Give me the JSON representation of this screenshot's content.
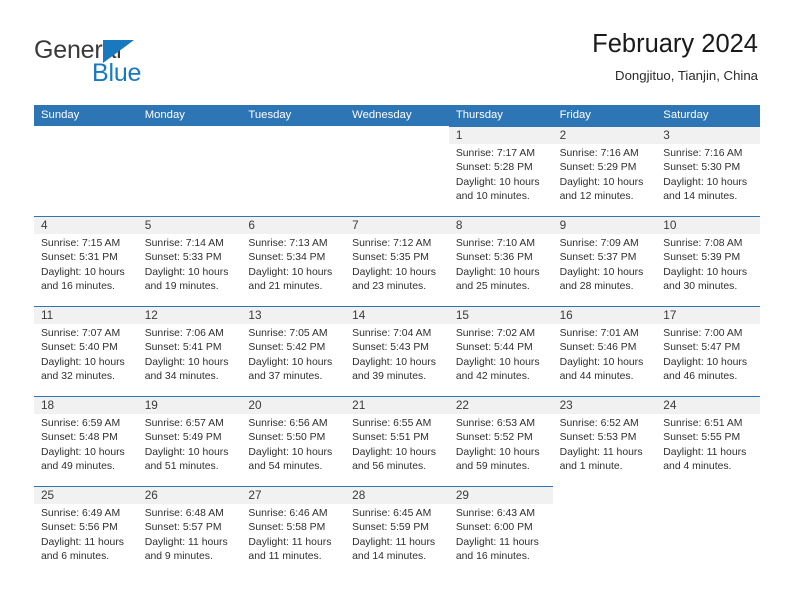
{
  "logo": {
    "word1": "General",
    "word2": "Blue",
    "triangle_color": "#1879bf",
    "word1_color": "#3a3a3a",
    "word2_color": "#1879bf",
    "icon": "triangle-flag-icon"
  },
  "header": {
    "title": "February 2024",
    "subtitle": "Dongjituo, Tianjin, China"
  },
  "colors": {
    "header_blue": "#2e75b6",
    "daynum_band": "#f1f1f1",
    "text": "#2f2f2f"
  },
  "weekdays": [
    "Sunday",
    "Monday",
    "Tuesday",
    "Wednesday",
    "Thursday",
    "Friday",
    "Saturday"
  ],
  "weeks": [
    [
      {
        "day": "",
        "state": "blank",
        "sunrise": "",
        "sunset": "",
        "daylight_1": "",
        "daylight_2": ""
      },
      {
        "day": "",
        "state": "blank",
        "sunrise": "",
        "sunset": "",
        "daylight_1": "",
        "daylight_2": ""
      },
      {
        "day": "",
        "state": "blank",
        "sunrise": "",
        "sunset": "",
        "daylight_1": "",
        "daylight_2": ""
      },
      {
        "day": "",
        "state": "blank",
        "sunrise": "",
        "sunset": "",
        "daylight_1": "",
        "daylight_2": ""
      },
      {
        "day": "1",
        "state": "filled",
        "sunrise": "Sunrise: 7:17 AM",
        "sunset": "Sunset: 5:28 PM",
        "daylight_1": "Daylight: 10 hours",
        "daylight_2": "and 10 minutes."
      },
      {
        "day": "2",
        "state": "filled",
        "sunrise": "Sunrise: 7:16 AM",
        "sunset": "Sunset: 5:29 PM",
        "daylight_1": "Daylight: 10 hours",
        "daylight_2": "and 12 minutes."
      },
      {
        "day": "3",
        "state": "filled",
        "sunrise": "Sunrise: 7:16 AM",
        "sunset": "Sunset: 5:30 PM",
        "daylight_1": "Daylight: 10 hours",
        "daylight_2": "and 14 minutes."
      }
    ],
    [
      {
        "day": "4",
        "state": "filled",
        "sunrise": "Sunrise: 7:15 AM",
        "sunset": "Sunset: 5:31 PM",
        "daylight_1": "Daylight: 10 hours",
        "daylight_2": "and 16 minutes."
      },
      {
        "day": "5",
        "state": "filled",
        "sunrise": "Sunrise: 7:14 AM",
        "sunset": "Sunset: 5:33 PM",
        "daylight_1": "Daylight: 10 hours",
        "daylight_2": "and 19 minutes."
      },
      {
        "day": "6",
        "state": "filled",
        "sunrise": "Sunrise: 7:13 AM",
        "sunset": "Sunset: 5:34 PM",
        "daylight_1": "Daylight: 10 hours",
        "daylight_2": "and 21 minutes."
      },
      {
        "day": "7",
        "state": "filled",
        "sunrise": "Sunrise: 7:12 AM",
        "sunset": "Sunset: 5:35 PM",
        "daylight_1": "Daylight: 10 hours",
        "daylight_2": "and 23 minutes."
      },
      {
        "day": "8",
        "state": "filled",
        "sunrise": "Sunrise: 7:10 AM",
        "sunset": "Sunset: 5:36 PM",
        "daylight_1": "Daylight: 10 hours",
        "daylight_2": "and 25 minutes."
      },
      {
        "day": "9",
        "state": "filled",
        "sunrise": "Sunrise: 7:09 AM",
        "sunset": "Sunset: 5:37 PM",
        "daylight_1": "Daylight: 10 hours",
        "daylight_2": "and 28 minutes."
      },
      {
        "day": "10",
        "state": "filled",
        "sunrise": "Sunrise: 7:08 AM",
        "sunset": "Sunset: 5:39 PM",
        "daylight_1": "Daylight: 10 hours",
        "daylight_2": "and 30 minutes."
      }
    ],
    [
      {
        "day": "11",
        "state": "filled",
        "sunrise": "Sunrise: 7:07 AM",
        "sunset": "Sunset: 5:40 PM",
        "daylight_1": "Daylight: 10 hours",
        "daylight_2": "and 32 minutes."
      },
      {
        "day": "12",
        "state": "filled",
        "sunrise": "Sunrise: 7:06 AM",
        "sunset": "Sunset: 5:41 PM",
        "daylight_1": "Daylight: 10 hours",
        "daylight_2": "and 34 minutes."
      },
      {
        "day": "13",
        "state": "filled",
        "sunrise": "Sunrise: 7:05 AM",
        "sunset": "Sunset: 5:42 PM",
        "daylight_1": "Daylight: 10 hours",
        "daylight_2": "and 37 minutes."
      },
      {
        "day": "14",
        "state": "filled",
        "sunrise": "Sunrise: 7:04 AM",
        "sunset": "Sunset: 5:43 PM",
        "daylight_1": "Daylight: 10 hours",
        "daylight_2": "and 39 minutes."
      },
      {
        "day": "15",
        "state": "filled",
        "sunrise": "Sunrise: 7:02 AM",
        "sunset": "Sunset: 5:44 PM",
        "daylight_1": "Daylight: 10 hours",
        "daylight_2": "and 42 minutes."
      },
      {
        "day": "16",
        "state": "filled",
        "sunrise": "Sunrise: 7:01 AM",
        "sunset": "Sunset: 5:46 PM",
        "daylight_1": "Daylight: 10 hours",
        "daylight_2": "and 44 minutes."
      },
      {
        "day": "17",
        "state": "filled",
        "sunrise": "Sunrise: 7:00 AM",
        "sunset": "Sunset: 5:47 PM",
        "daylight_1": "Daylight: 10 hours",
        "daylight_2": "and 46 minutes."
      }
    ],
    [
      {
        "day": "18",
        "state": "filled",
        "sunrise": "Sunrise: 6:59 AM",
        "sunset": "Sunset: 5:48 PM",
        "daylight_1": "Daylight: 10 hours",
        "daylight_2": "and 49 minutes."
      },
      {
        "day": "19",
        "state": "filled",
        "sunrise": "Sunrise: 6:57 AM",
        "sunset": "Sunset: 5:49 PM",
        "daylight_1": "Daylight: 10 hours",
        "daylight_2": "and 51 minutes."
      },
      {
        "day": "20",
        "state": "filled",
        "sunrise": "Sunrise: 6:56 AM",
        "sunset": "Sunset: 5:50 PM",
        "daylight_1": "Daylight: 10 hours",
        "daylight_2": "and 54 minutes."
      },
      {
        "day": "21",
        "state": "filled",
        "sunrise": "Sunrise: 6:55 AM",
        "sunset": "Sunset: 5:51 PM",
        "daylight_1": "Daylight: 10 hours",
        "daylight_2": "and 56 minutes."
      },
      {
        "day": "22",
        "state": "filled",
        "sunrise": "Sunrise: 6:53 AM",
        "sunset": "Sunset: 5:52 PM",
        "daylight_1": "Daylight: 10 hours",
        "daylight_2": "and 59 minutes."
      },
      {
        "day": "23",
        "state": "filled",
        "sunrise": "Sunrise: 6:52 AM",
        "sunset": "Sunset: 5:53 PM",
        "daylight_1": "Daylight: 11 hours",
        "daylight_2": "and 1 minute."
      },
      {
        "day": "24",
        "state": "filled",
        "sunrise": "Sunrise: 6:51 AM",
        "sunset": "Sunset: 5:55 PM",
        "daylight_1": "Daylight: 11 hours",
        "daylight_2": "and 4 minutes."
      }
    ],
    [
      {
        "day": "25",
        "state": "filled",
        "sunrise": "Sunrise: 6:49 AM",
        "sunset": "Sunset: 5:56 PM",
        "daylight_1": "Daylight: 11 hours",
        "daylight_2": "and 6 minutes."
      },
      {
        "day": "26",
        "state": "filled",
        "sunrise": "Sunrise: 6:48 AM",
        "sunset": "Sunset: 5:57 PM",
        "daylight_1": "Daylight: 11 hours",
        "daylight_2": "and 9 minutes."
      },
      {
        "day": "27",
        "state": "filled",
        "sunrise": "Sunrise: 6:46 AM",
        "sunset": "Sunset: 5:58 PM",
        "daylight_1": "Daylight: 11 hours",
        "daylight_2": "and 11 minutes."
      },
      {
        "day": "28",
        "state": "filled",
        "sunrise": "Sunrise: 6:45 AM",
        "sunset": "Sunset: 5:59 PM",
        "daylight_1": "Daylight: 11 hours",
        "daylight_2": "and 14 minutes."
      },
      {
        "day": "29",
        "state": "filled",
        "sunrise": "Sunrise: 6:43 AM",
        "sunset": "Sunset: 6:00 PM",
        "daylight_1": "Daylight: 11 hours",
        "daylight_2": "and 16 minutes."
      },
      {
        "day": "",
        "state": "blank",
        "sunrise": "",
        "sunset": "",
        "daylight_1": "",
        "daylight_2": ""
      },
      {
        "day": "",
        "state": "blank",
        "sunrise": "",
        "sunset": "",
        "daylight_1": "",
        "daylight_2": ""
      }
    ]
  ]
}
